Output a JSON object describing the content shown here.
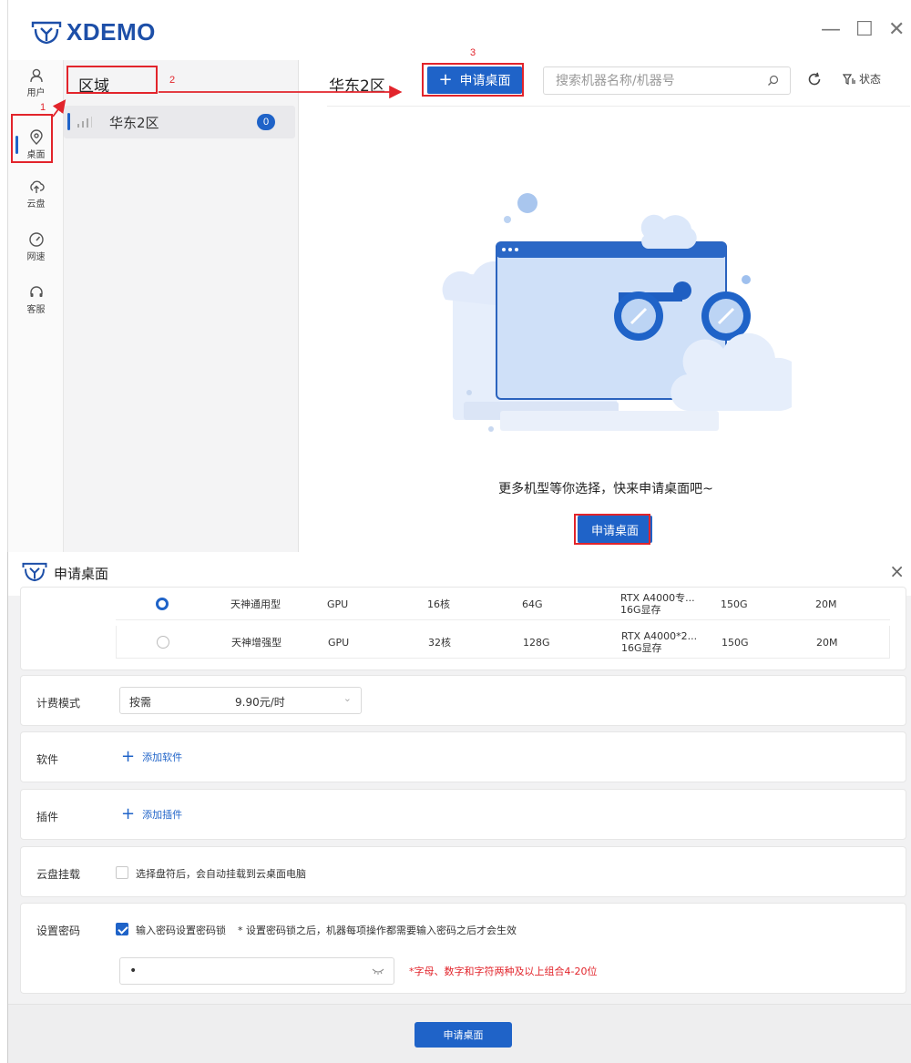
{
  "app": {
    "name": "XDEMO"
  },
  "window_controls": {
    "minimize": "—",
    "maximize": "☐",
    "close": "✕"
  },
  "nav": {
    "items": [
      {
        "label": "用户",
        "icon": "user-icon"
      },
      {
        "label": "桌面",
        "icon": "location-pin-icon"
      },
      {
        "label": "云盘",
        "icon": "cloud-upload-icon"
      },
      {
        "label": "网速",
        "icon": "speed-gauge-icon"
      },
      {
        "label": "客服",
        "icon": "headset-icon"
      }
    ]
  },
  "annotations": {
    "step1": "1",
    "step2": "2",
    "step3": "3"
  },
  "region_panel": {
    "title": "区域",
    "items": [
      {
        "name": "华东2区",
        "count": "0"
      }
    ]
  },
  "main": {
    "title": "华东2区",
    "apply_button": "申请桌面",
    "search_placeholder": "搜索机器名称/机器号",
    "filter_label": "状态",
    "empty_text": "更多机型等你选择，快来申请桌面吧~",
    "empty_button": "申请桌面"
  },
  "dialog": {
    "title": "申请桌面",
    "close": "×",
    "configs": [
      {
        "selected": true,
        "name": "天神通用型",
        "type": "GPU",
        "cpu": "16核",
        "memory": "64G",
        "gpu_line1": "RTX A4000专...",
        "gpu_line2": "16G显存",
        "disk": "150G",
        "bandwidth": "20M"
      },
      {
        "selected": false,
        "name": "天神增强型",
        "type": "GPU",
        "cpu": "32核",
        "memory": "128G",
        "gpu_line1": "RTX A4000*2...",
        "gpu_line2": "16G显存",
        "disk": "150G",
        "bandwidth": "20M"
      }
    ],
    "billing": {
      "label": "计费模式",
      "mode": "按需",
      "price": "9.90元/时"
    },
    "software": {
      "label": "软件",
      "add": "添加软件"
    },
    "plugin": {
      "label": "插件",
      "add": "添加插件"
    },
    "cloud_disk": {
      "label": "云盘挂载",
      "checked": false,
      "text": "选择盘符后，会自动挂载到云桌面电脑"
    },
    "password": {
      "label": "设置密码",
      "checked": true,
      "checkbox_text": "输入密码设置密码锁",
      "note": "* 设置密码锁之后，机器每项操作都需要输入密码之后才会生效",
      "value": "•",
      "hint": "*字母、数字和字符两种及以上组合4-20位"
    },
    "submit": "申请桌面"
  },
  "colors": {
    "primary": "#1f63c8",
    "annotation": "#e2242b"
  }
}
